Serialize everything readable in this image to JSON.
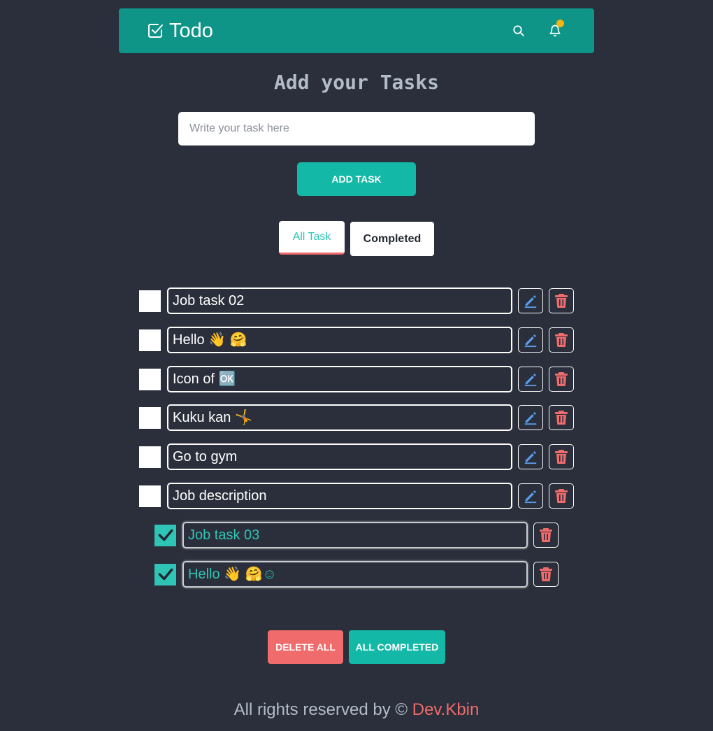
{
  "header": {
    "title": "Todo",
    "icons": [
      "checkbox-icon",
      "search-icon",
      "bell-icon"
    ],
    "brand_color": "#0f9488",
    "notification_dot_color": "#f6b40e"
  },
  "main": {
    "heading": "Add your Tasks",
    "input": {
      "placeholder": "Write your task here",
      "value": ""
    },
    "add_button_label": "ADD TASK",
    "tabs": [
      {
        "label": "All Task",
        "active": true
      },
      {
        "label": "Completed",
        "active": false
      }
    ]
  },
  "tasks": [
    {
      "text": "Job task 02",
      "completed": false
    },
    {
      "text": "Hello 👋 🤗",
      "completed": false
    },
    {
      "text": "Icon of 🆗",
      "completed": false
    },
    {
      "text": "Kuku kan 🤸",
      "completed": false
    },
    {
      "text": "Go to gym",
      "completed": false
    },
    {
      "text": "Job description",
      "completed": false
    },
    {
      "text": "Job task 03",
      "completed": true
    },
    {
      "text": "Hello 👋 🤗☺",
      "completed": true
    }
  ],
  "actions": {
    "delete_all_label": "DELETE ALL",
    "all_completed_label": "ALL COMPLETED"
  },
  "footer": {
    "text": "All rights reserved by © ",
    "link": "Dev.Kbin"
  },
  "colors": {
    "background": "#2a2f3b",
    "accent": "#14b8a6",
    "danger": "#f06b6b",
    "edit": "#5b9bea"
  }
}
